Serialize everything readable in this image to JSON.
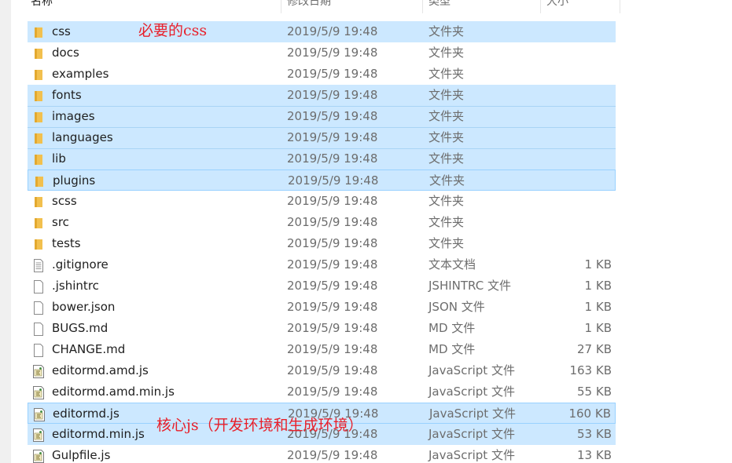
{
  "columns": {
    "name": "名称",
    "date": "修改日期",
    "type": "类型",
    "size": "大小"
  },
  "colors": {
    "selection": "#cce8ff",
    "selection_border": "#99d1ff",
    "folder": "#f2c04e",
    "annotation": "#e8202a"
  },
  "files": [
    {
      "name": "css",
      "date": "2019/5/9 19:48",
      "type": "文件夹",
      "size": "",
      "icon": "folder-icon",
      "selected": true
    },
    {
      "name": "docs",
      "date": "2019/5/9 19:48",
      "type": "文件夹",
      "size": "",
      "icon": "folder-icon",
      "selected": false
    },
    {
      "name": "examples",
      "date": "2019/5/9 19:48",
      "type": "文件夹",
      "size": "",
      "icon": "folder-icon",
      "selected": false
    },
    {
      "name": "fonts",
      "date": "2019/5/9 19:48",
      "type": "文件夹",
      "size": "",
      "icon": "folder-icon",
      "selected": true
    },
    {
      "name": "images",
      "date": "2019/5/9 19:48",
      "type": "文件夹",
      "size": "",
      "icon": "folder-icon",
      "selected": true
    },
    {
      "name": "languages",
      "date": "2019/5/9 19:48",
      "type": "文件夹",
      "size": "",
      "icon": "folder-icon",
      "selected": true
    },
    {
      "name": "lib",
      "date": "2019/5/9 19:48",
      "type": "文件夹",
      "size": "",
      "icon": "folder-icon",
      "selected": true
    },
    {
      "name": "plugins",
      "date": "2019/5/9 19:48",
      "type": "文件夹",
      "size": "",
      "icon": "folder-icon",
      "selected": true,
      "focused": true
    },
    {
      "name": "scss",
      "date": "2019/5/9 19:48",
      "type": "文件夹",
      "size": "",
      "icon": "folder-icon",
      "selected": false
    },
    {
      "name": "src",
      "date": "2019/5/9 19:48",
      "type": "文件夹",
      "size": "",
      "icon": "folder-icon",
      "selected": false
    },
    {
      "name": "tests",
      "date": "2019/5/9 19:48",
      "type": "文件夹",
      "size": "",
      "icon": "folder-icon",
      "selected": false
    },
    {
      "name": ".gitignore",
      "date": "2019/5/9 19:48",
      "type": "文本文档",
      "size": "1 KB",
      "icon": "text-file-icon",
      "selected": false
    },
    {
      "name": ".jshintrc",
      "date": "2019/5/9 19:48",
      "type": "JSHINTRC 文件",
      "size": "1 KB",
      "icon": "blank-file-icon",
      "selected": false
    },
    {
      "name": "bower.json",
      "date": "2019/5/9 19:48",
      "type": "JSON 文件",
      "size": "1 KB",
      "icon": "blank-file-icon",
      "selected": false
    },
    {
      "name": "BUGS.md",
      "date": "2019/5/9 19:48",
      "type": "MD 文件",
      "size": "1 KB",
      "icon": "blank-file-icon",
      "selected": false
    },
    {
      "name": "CHANGE.md",
      "date": "2019/5/9 19:48",
      "type": "MD 文件",
      "size": "27 KB",
      "icon": "blank-file-icon",
      "selected": false
    },
    {
      "name": "editormd.amd.js",
      "date": "2019/5/9 19:48",
      "type": "JavaScript 文件",
      "size": "163 KB",
      "icon": "js-file-icon",
      "selected": false
    },
    {
      "name": "editormd.amd.min.js",
      "date": "2019/5/9 19:48",
      "type": "JavaScript 文件",
      "size": "55 KB",
      "icon": "js-file-icon",
      "selected": false
    },
    {
      "name": "editormd.js",
      "date": "2019/5/9 19:48",
      "type": "JavaScript 文件",
      "size": "160 KB",
      "icon": "js-file-icon",
      "selected": true,
      "focused": true
    },
    {
      "name": "editormd.min.js",
      "date": "2019/5/9 19:48",
      "type": "JavaScript 文件",
      "size": "53 KB",
      "icon": "js-file-icon",
      "selected": true
    },
    {
      "name": "Gulpfile.js",
      "date": "2019/5/9 19:48",
      "type": "JavaScript 文件",
      "size": "13 KB",
      "icon": "js-file-icon",
      "selected": false
    }
  ],
  "annotations": {
    "css_note": "必要的css",
    "core_note": "核心js（开发环境和生成环境）"
  }
}
